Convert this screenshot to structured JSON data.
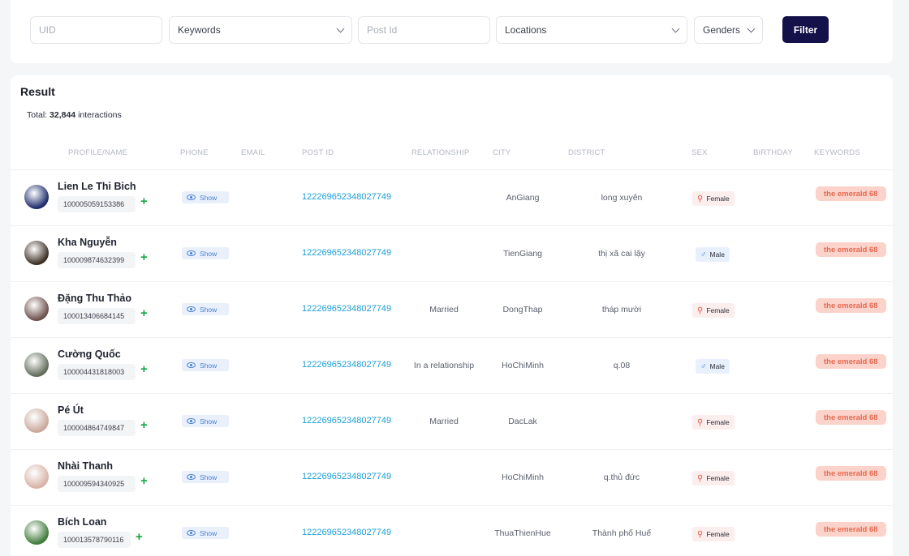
{
  "filters": {
    "uid_placeholder": "UID",
    "keywords_label": "Keywords",
    "postid_placeholder": "Post Id",
    "locations_label": "Locations",
    "genders_label": "Genders",
    "filter_button": "Filter"
  },
  "result": {
    "title": "Result",
    "total_prefix": "Total:",
    "total_count": "32,844",
    "total_suffix": "interactions"
  },
  "columns": [
    "PROFILE/NAME",
    "PHONE",
    "EMAIL",
    "POST ID",
    "RELATIONSHIP",
    "CITY",
    "DISTRICT",
    "SEX",
    "BIRTHDAY",
    "KEYWORDS"
  ],
  "show_label": "Show",
  "rows": [
    {
      "name": "Lien Le Thi Bich",
      "uid": "100005059153386",
      "post_id": "122269652348027749",
      "relationship": "",
      "city": "AnGiang",
      "district": "long xuyên",
      "sex": "Female",
      "keyword": "the emerald 68",
      "avatar_color": "#1c2a6b"
    },
    {
      "name": "Kha Nguyễn",
      "uid": "100009874632399",
      "post_id": "122269652348027749",
      "relationship": "",
      "city": "TienGiang",
      "district": "thị xã cai lậy",
      "sex": "Male",
      "keyword": "the emerald 68",
      "avatar_color": "#3b2e22"
    },
    {
      "name": "Đặng Thu Thảo",
      "uid": "100013406684145",
      "post_id": "122269652348027749",
      "relationship": "Married",
      "city": "DongThap",
      "district": "tháp mười",
      "sex": "Female",
      "keyword": "the emerald 68",
      "avatar_color": "#6b4f4a"
    },
    {
      "name": "Cường Quốc",
      "uid": "100004431818003",
      "post_id": "122269652348027749",
      "relationship": "In a relationship",
      "city": "HoChiMinh",
      "district": "q.08",
      "sex": "Male",
      "keyword": "the emerald 68",
      "avatar_color": "#5f6b58"
    },
    {
      "name": "Pé Út",
      "uid": "100004864749847",
      "post_id": "122269652348027749",
      "relationship": "Married",
      "city": "DacLak",
      "district": "",
      "sex": "Female",
      "keyword": "the emerald 68",
      "avatar_color": "#c9a89a"
    },
    {
      "name": "Nhài Thanh",
      "uid": "100009594340925",
      "post_id": "122269652348027749",
      "relationship": "",
      "city": "HoChiMinh",
      "district": "q.thủ đức",
      "sex": "Female",
      "keyword": "the emerald 68",
      "avatar_color": "#d7b3a6"
    },
    {
      "name": "Bích Loan",
      "uid": "100013578790116",
      "post_id": "122269652348027749",
      "relationship": "",
      "city": "ThuaThienHue",
      "district": "Thành phố Huế",
      "sex": "Female",
      "keyword": "the emerald 68",
      "avatar_color": "#3f7a3a"
    }
  ]
}
